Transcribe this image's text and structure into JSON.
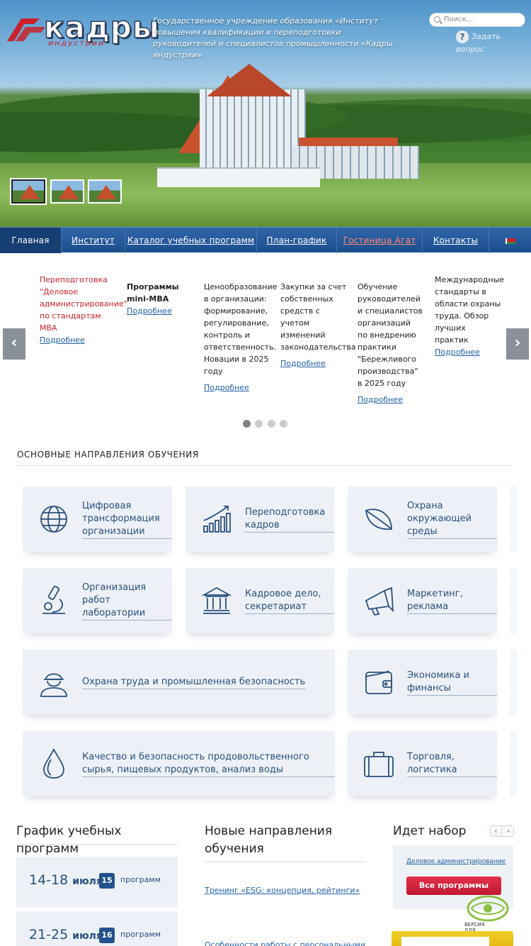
{
  "header": {
    "logo_text": "кадры",
    "logo_sub": "индустрии",
    "description": "Государственное учреждение образования «Институт повышения квалификации и переподготовки руководителей и специалистов промышленности «Кадры индустрии»",
    "search_placeholder": "Поиск...",
    "ask_icon": "?",
    "ask_label": "Задать вопрос"
  },
  "nav": {
    "items": [
      {
        "label": "Главная"
      },
      {
        "label": "Институт"
      },
      {
        "label": "Каталог учебных программ"
      },
      {
        "label": "План-график"
      },
      {
        "label": "Гостиница Агат"
      },
      {
        "label": "Контакты"
      }
    ],
    "flag_icon": "belarus-flag-icon"
  },
  "carousel": {
    "prev": "‹",
    "next": "›",
    "more_label": "Подробнее",
    "cards": [
      {
        "title": "Переподготовка \"Деловое администрирование\" по стандартам MBA"
      },
      {
        "title": "Программы mini-MBA"
      },
      {
        "title": "Ценообразование в организации: формирование, регулирование, контроль и ответственность. Новации в 2025 году"
      },
      {
        "title": "Закупки за счет собственных средств с учетом изменений законодательства"
      },
      {
        "title": "Обучение руководителей и специалистов организаций по внедрению практики \"Бережливого производства\" в 2025 году"
      },
      {
        "title": "Международные стандарты в области охраны труда. Обзор лучших практик"
      }
    ],
    "pages": 4,
    "active_page": 0
  },
  "directions": {
    "title": "ОСНОВНЫЕ НАПРАВЛЕНИЯ ОБУЧЕНИЯ",
    "tiles": [
      {
        "label": "Цифровая трансформация организации",
        "icon": "globe-icon"
      },
      {
        "label": "Переподготовка кадров",
        "icon": "growth-chart-icon"
      },
      {
        "label": "Охрана окружающей среды",
        "icon": "leaf-icon"
      },
      {
        "label": "Организация работ лаборатории",
        "icon": "microscope-icon"
      },
      {
        "label": "Кадровое дело, секретариат",
        "icon": "institution-icon"
      },
      {
        "label": "Маркетинг, реклама",
        "icon": "megaphone-icon"
      },
      {
        "label": "Охрана труда и промышленная безопасность",
        "icon": "worker-helmet-icon"
      },
      {
        "label": "Экономика и финансы",
        "icon": "wallet-icon"
      },
      {
        "label": "Качество и безопасность продовольственного сырья, пищевых продуктов, анализ воды",
        "icon": "water-drop-icon"
      },
      {
        "label": "Торговля, логистика",
        "icon": "suitcase-icon"
      }
    ]
  },
  "schedule": {
    "title": "График учебных программ",
    "weeks": [
      {
        "dates": "14-18",
        "month": "июля",
        "count": "15",
        "count_label": "программ"
      },
      {
        "dates": "21-25",
        "month": "июля",
        "count": "16",
        "count_label": "программ"
      }
    ]
  },
  "new_directions": {
    "title": "Новые направления обучения",
    "links": [
      {
        "label": "Тренинг «ESG: концепция, рейтинги»"
      },
      {
        "label": "Особенности работы с персональными"
      }
    ]
  },
  "enrollment": {
    "title": "Идет набор",
    "item": "Деловое администрирование",
    "button": "Все программы",
    "prev": "‹",
    "next": "›"
  },
  "accessibility": {
    "label_line1": "ВЕРСИЯ",
    "label_line2": "ДЛЯ СЛАБОВИДЯЩИХ"
  },
  "colors": {
    "nav_blue": "#1d4e8e",
    "link_blue": "#1f5fa5",
    "accent_red": "#c8232c",
    "tile_bg": "#edf1f7"
  }
}
